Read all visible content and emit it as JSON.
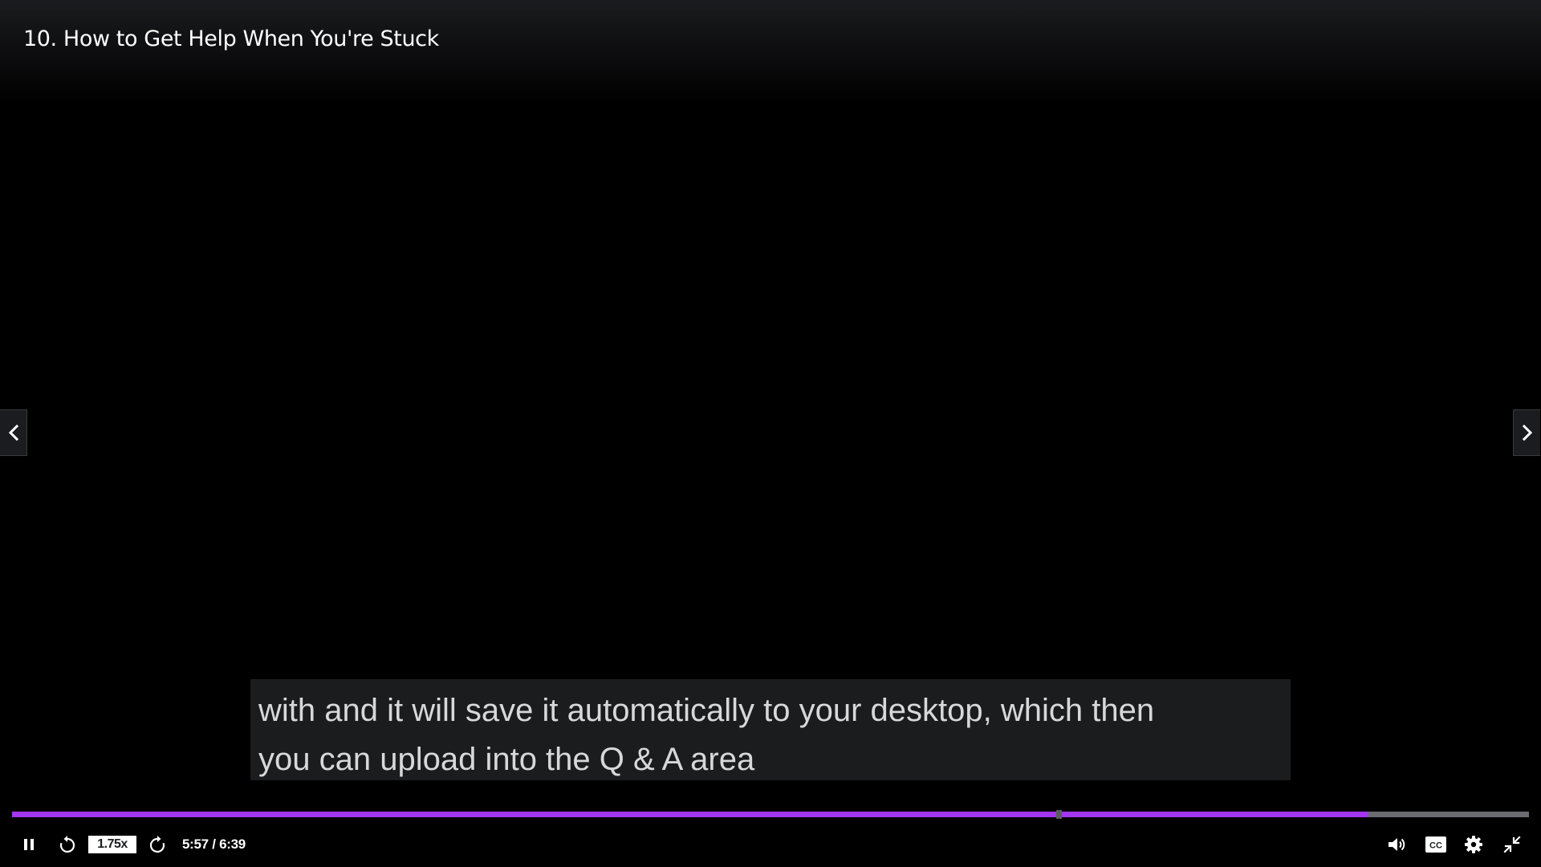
{
  "video": {
    "title": "10. How to Get Help When You're Stuck"
  },
  "navigation": {
    "previous_icon": "chevron-left-icon",
    "next_icon": "chevron-right-icon"
  },
  "caption": {
    "lines": [
      "with and it will save it automatically to your desktop, which then",
      "you can upload into the Q & A area"
    ]
  },
  "progress": {
    "played_fraction": 0.894,
    "marker_fraction": 0.69,
    "played_color": "#a435f0",
    "track_color": "#6b6c70"
  },
  "controls": {
    "play_pause_icon": "pause-icon",
    "rewind_icon": "rewind-icon",
    "speed_label": "1.75x",
    "forward_icon": "forward-icon",
    "time": "5:57 / 6:39",
    "volume_icon": "volume-icon",
    "captions_icon": "closed-captions-icon",
    "settings_icon": "gear-icon",
    "exit_fullscreen_icon": "exit-fullscreen-icon"
  }
}
